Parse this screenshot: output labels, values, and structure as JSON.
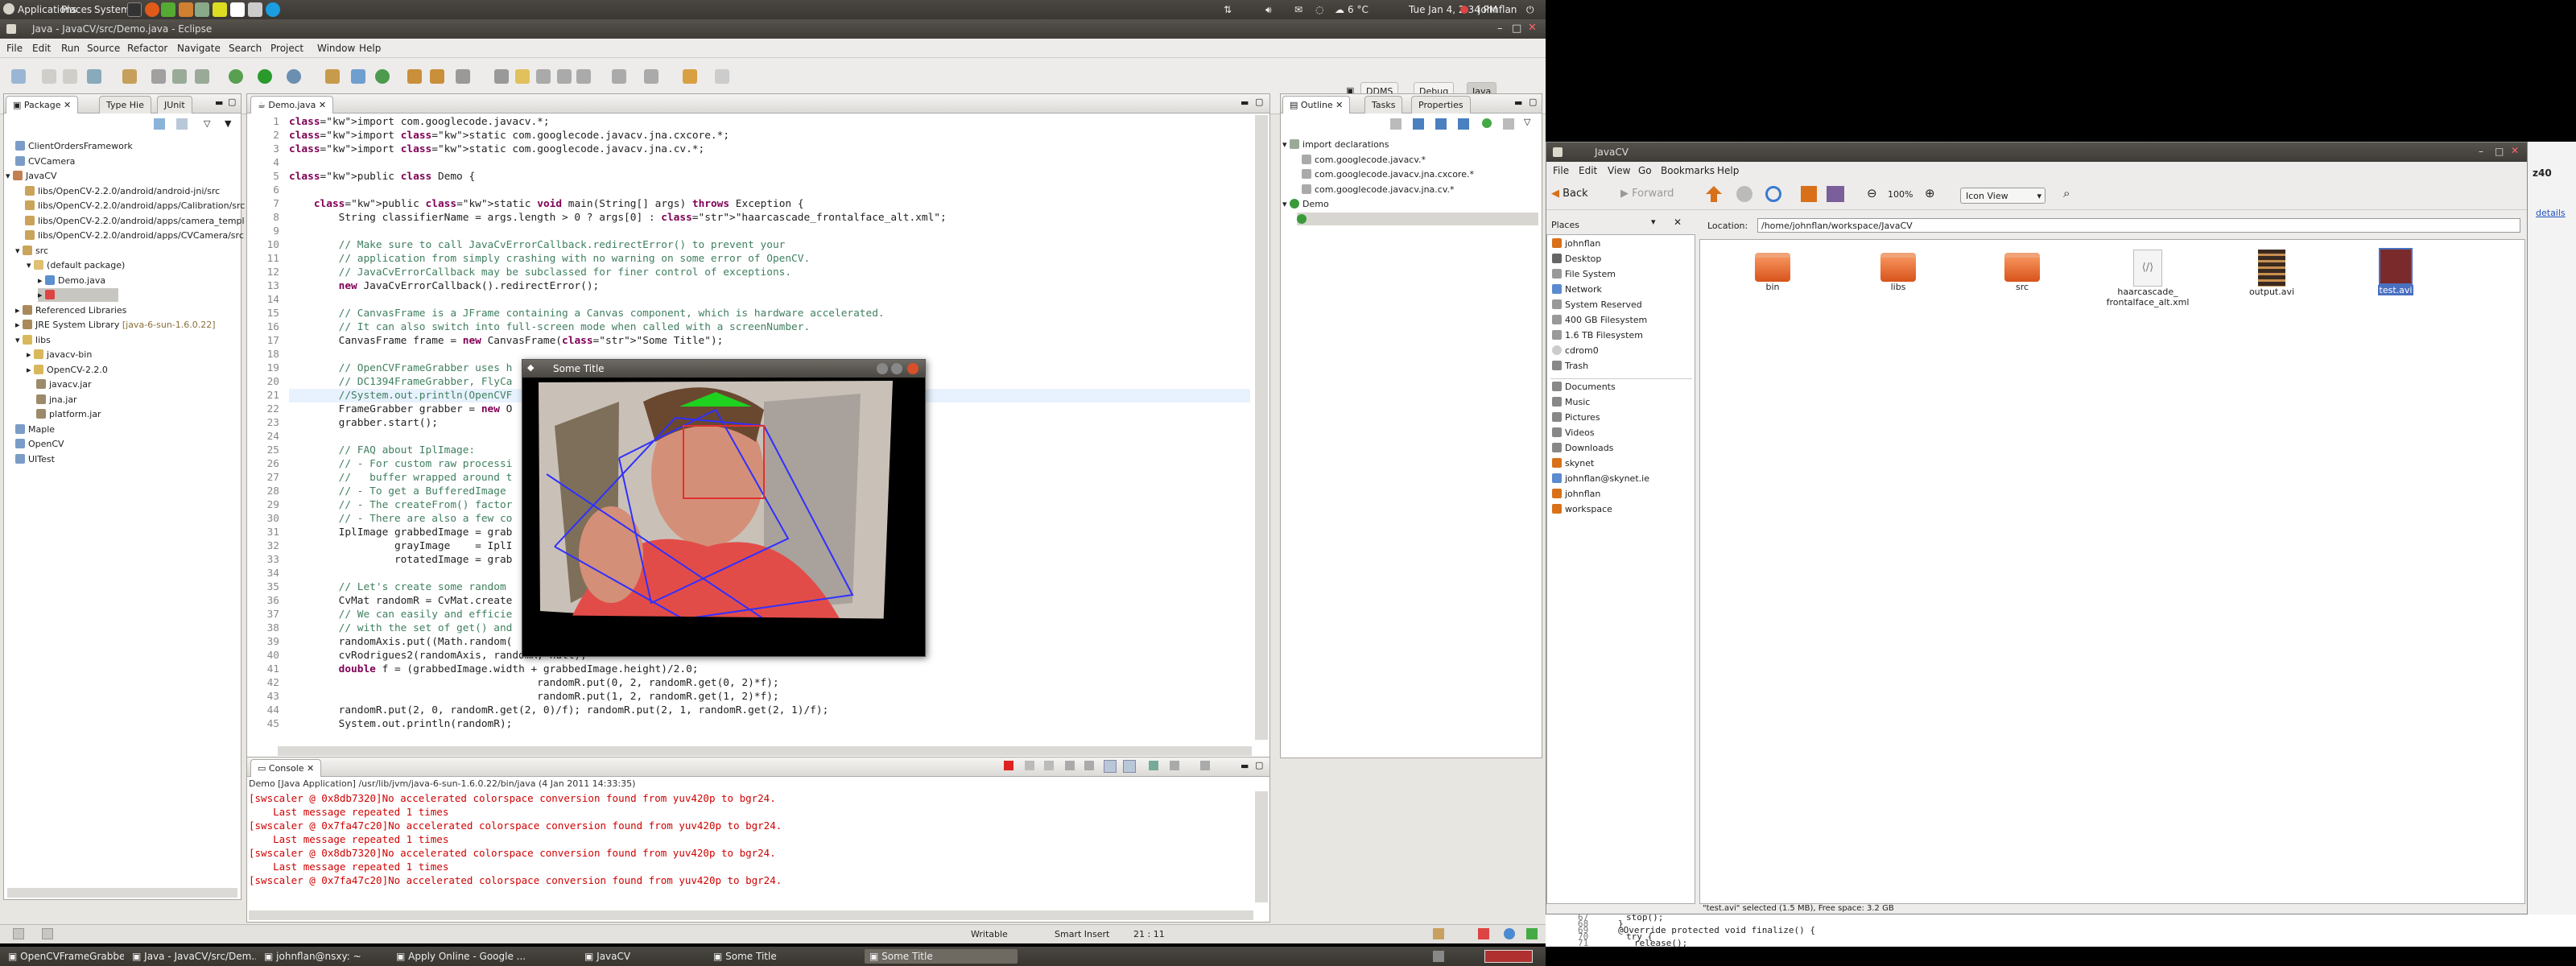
{
  "top_panel": {
    "menus": [
      "Applications",
      "Places",
      "System"
    ],
    "weather": "6 °C",
    "clock": "Tue Jan 4,  2:34 PM",
    "user": "johnflan"
  },
  "eclipse": {
    "title": "Java - JavaCV/src/Demo.java - Eclipse",
    "menu": [
      "File",
      "Edit",
      "Run",
      "Source",
      "Refactor",
      "Navigate",
      "Search",
      "Project",
      "Window",
      "Help"
    ],
    "perspectives": [
      "DDMS",
      "Debug",
      "Java"
    ],
    "package_tabs": [
      "Package",
      "Type Hie",
      "JUnit"
    ],
    "tree": [
      "ClientOrdersFramework",
      "CVCamera",
      "JavaCV",
      "libs/OpenCV-2.2.0/android/android-jni/src",
      "libs/OpenCV-2.2.0/android/apps/Calibration/src",
      "libs/OpenCV-2.2.0/android/apps/camera_templ",
      "libs/OpenCV-2.2.0/android/apps/CVCamera/src",
      "src",
      "(default package)",
      "Demo.java",
      "",
      "Referenced Libraries",
      "JRE System Library",
      "libs",
      "javacv-bin",
      "OpenCV-2.2.0",
      "javacv.jar",
      "jna.jar",
      "platform.jar",
      "Maple",
      "OpenCV",
      "UITest"
    ],
    "jre_label": "[java-6-sun-1.6.0.22]",
    "editor_tab": "Demo.java",
    "code_lines": [
      "import com.googlecode.javacv.*;",
      "import static com.googlecode.javacv.jna.cxcore.*;",
      "import static com.googlecode.javacv.jna.cv.*;",
      "",
      "public class Demo {",
      "",
      "    public static void main(String[] args) throws Exception {",
      "        String classifierName = args.length > 0 ? args[0] : \"haarcascade_frontalface_alt.xml\";",
      "",
      "        // Make sure to call JavaCvErrorCallback.redirectError() to prevent your",
      "        // application from simply crashing with no warning on some error of OpenCV.",
      "        // JavaCvErrorCallback may be subclassed for finer control of exceptions.",
      "        new JavaCvErrorCallback().redirectError();",
      "",
      "        // CanvasFrame is a JFrame containing a Canvas component, which is hardware accelerated.",
      "        // It can also switch into full-screen mode when called with a screenNumber.",
      "        CanvasFrame frame = new CanvasFrame(\"Some Title\");",
      "",
      "        // OpenCVFrameGrabber uses h",
      "        // DC1394FrameGrabber, FlyCa",
      "        //System.out.println(OpenCVF",
      "        FrameGrabber grabber = new O",
      "        grabber.start();",
      "",
      "        // FAQ about IplImage:",
      "        // - For custom raw processi",
      "        //   buffer wrapped around t",
      "        // - To get a BufferedImage ",
      "        // - The createFrom() factor",
      "        // - There are also a few co",
      "        IplImage grabbedImage = grab",
      "                 grayImage    = IplI                                              8U, 1),",
      "                 rotatedImage = grab",
      "",
      "        // Let's create some random ",
      "        CvMat randomR = CvMat.create",
      "        // We can easily and efficie",
      "        // with the set of get() and",
      "        randomAxis.put((Math.random(",
      "        cvRodrigues2(randomAxis, randomR, null);",
      "        double f = (grabbedImage.width + grabbedImage.height)/2.0;",
      "                                        randomR.put(0, 2, randomR.get(0, 2)*f);",
      "                                        randomR.put(1, 2, randomR.get(1, 2)*f);",
      "        randomR.put(2, 0, randomR.get(2, 0)/f); randomR.put(2, 1, randomR.get(2, 1)/f);",
      "        System.out.println(randomR);"
    ],
    "outline_tabs": [
      "Outline",
      "Tasks",
      "Properties"
    ],
    "outline": [
      "import declarations",
      "com.googlecode.javacv.*",
      "com.googlecode.javacv.jna.cxcore.*",
      "com.googlecode.javacv.jna.cv.*",
      "Demo"
    ],
    "console_tab": "Console",
    "console_header": "Demo [Java Application] /usr/lib/jvm/java-6-sun-1.6.0.22/bin/java (4 Jan 2011 14:33:35)",
    "console_lines": [
      "[swscaler @ 0x8db7320]No accelerated colorspace conversion found from yuv420p to bgr24.",
      "    Last message repeated 1 times",
      "[swscaler @ 0x7fa47c20]No accelerated colorspace conversion found from yuv420p to bgr24.",
      "    Last message repeated 1 times",
      "[swscaler @ 0x8db7320]No accelerated colorspace conversion found from yuv420p to bgr24.",
      "    Last message repeated 1 times",
      "[swscaler @ 0x7fa47c20]No accelerated colorspace conversion found from yuv420p to bgr24."
    ],
    "status": {
      "writable": "Writable",
      "insert": "Smart Insert",
      "position": "21 : 11"
    }
  },
  "canvas_frame": {
    "title": "Some Title"
  },
  "nautilus": {
    "title": "JavaCV",
    "menu": [
      "File",
      "Edit",
      "View",
      "Go",
      "Bookmarks",
      "Help"
    ],
    "back": "Back",
    "forward": "Forward",
    "zoom": "100%",
    "view_mode": "Icon View",
    "places_label": "Places",
    "location_label": "Location:",
    "location": "/home/johnflan/workspace/JavaCV",
    "places": [
      "johnflan",
      "Desktop",
      "File System",
      "Network",
      "System Reserved",
      "400 GB Filesystem",
      "1.6 TB Filesystem",
      "cdrom0",
      "Trash"
    ],
    "bookmarks": [
      "Documents",
      "Music",
      "Pictures",
      "Videos",
      "Downloads",
      "skynet",
      "johnflan@skynet.ie",
      "johnflan",
      "workspace"
    ],
    "files": [
      "bin",
      "libs",
      "src",
      "haarcascade_\nfrontalface_alt.xml",
      "output.avi",
      "test.avi"
    ],
    "status": "\"test.avi\" selected (1.5 MB), Free space: 3.2 GB"
  },
  "background_code": [
    "stop();",
    "}",
    "@Override protected void finalize() {",
    "try {",
    "release();"
  ],
  "background_line_numbers": [
    "67",
    "68",
    "69",
    "70",
    "71"
  ],
  "side_label": "details",
  "taskbar": [
    "OpenCVFrameGrabber....",
    "Java - JavaCV/src/Dem...",
    "johnflan@nsxy: ~",
    "Apply Online - Google ...",
    "JavaCV",
    "Some Title",
    "Some Title"
  ],
  "colors": {
    "error_red": "#d00000",
    "keyword": "#7f0055",
    "string": "#2a00ff",
    "comment": "#3f7f5f",
    "folder_orange": "#e8652a"
  }
}
